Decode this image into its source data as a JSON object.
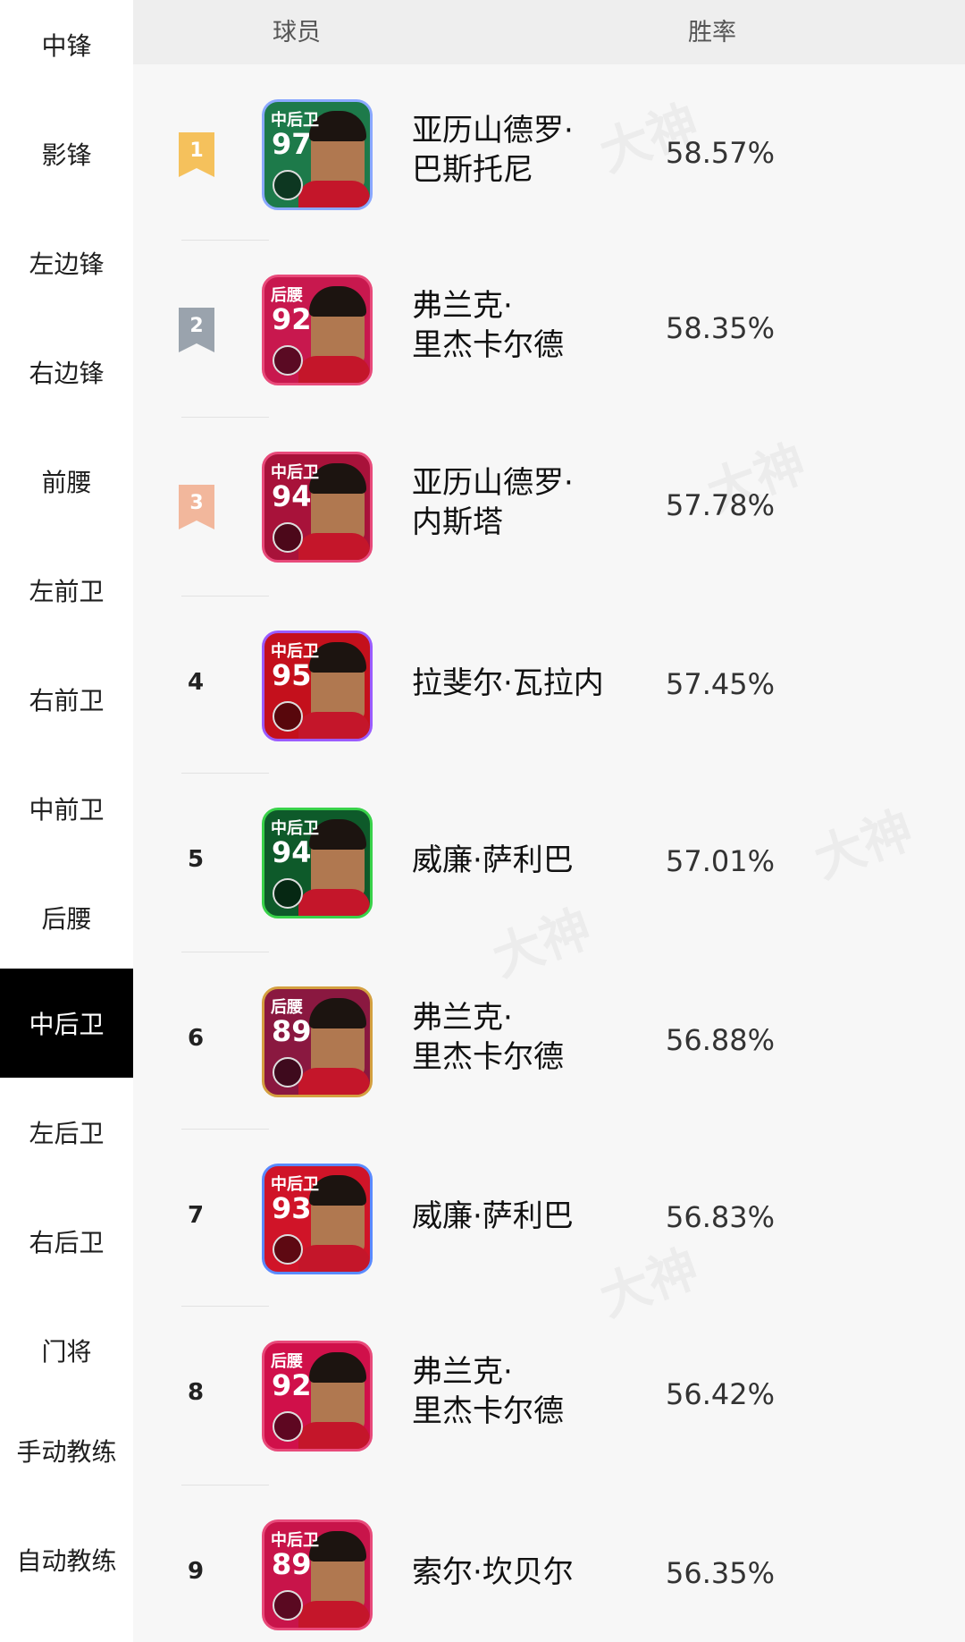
{
  "sidebar": {
    "items": [
      "中锋",
      "影锋",
      "左边锋",
      "右边锋",
      "前腰",
      "左前卫",
      "右前卫",
      "中前卫",
      "后腰",
      "中后卫",
      "左后卫",
      "右后卫",
      "门将",
      "手动教练",
      "自动教练"
    ],
    "active_index": 9
  },
  "header": {
    "player_col": "球员",
    "winrate_col": "胜率"
  },
  "watermark": "大神",
  "rows": [
    {
      "rank": "1",
      "position": "中后卫",
      "rating": "97",
      "name_line1": "亚历山德罗·",
      "name_line2": "巴斯托尼",
      "winrate": "58.57%",
      "badge_color": "#f5c15c",
      "card_bg": "#1d7a4a",
      "frame_color": "#8aa8ff"
    },
    {
      "rank": "2",
      "position": "后腰",
      "rating": "92",
      "name_line1": "弗兰克·",
      "name_line2": "里杰卡尔德",
      "winrate": "58.35%",
      "badge_color": "#9aa3ad",
      "card_bg": "#c8184e",
      "frame_color": "#e84a7a"
    },
    {
      "rank": "3",
      "position": "中后卫",
      "rating": "94",
      "name_line1": "亚历山德罗·",
      "name_line2": "内斯塔",
      "winrate": "57.78%",
      "badge_color": "#f2b79c",
      "card_bg": "#a8123a",
      "frame_color": "#e84a7a"
    },
    {
      "rank": "4",
      "position": "中后卫",
      "rating": "95",
      "name_line1": "拉斐尔·瓦拉内",
      "name_line2": "",
      "winrate": "57.45%",
      "badge_color": "",
      "card_bg": "#c4101c",
      "frame_color": "#9a5cff"
    },
    {
      "rank": "5",
      "position": "中后卫",
      "rating": "94",
      "name_line1": "威廉·萨利巴",
      "name_line2": "",
      "winrate": "57.01%",
      "badge_color": "",
      "card_bg": "#0e5a2a",
      "frame_color": "#39d24a"
    },
    {
      "rank": "6",
      "position": "后腰",
      "rating": "89",
      "name_line1": "弗兰克·",
      "name_line2": "里杰卡尔德",
      "winrate": "56.88%",
      "badge_color": "",
      "card_bg": "#8a1840",
      "frame_color": "#d4a040"
    },
    {
      "rank": "7",
      "position": "中后卫",
      "rating": "93",
      "name_line1": "威廉·萨利巴",
      "name_line2": "",
      "winrate": "56.83%",
      "badge_color": "",
      "card_bg": "#d01428",
      "frame_color": "#5a8aff"
    },
    {
      "rank": "8",
      "position": "后腰",
      "rating": "92",
      "name_line1": "弗兰克·",
      "name_line2": "里杰卡尔德",
      "winrate": "56.42%",
      "badge_color": "",
      "card_bg": "#d0104a",
      "frame_color": "#e84a7a"
    },
    {
      "rank": "9",
      "position": "中后卫",
      "rating": "89",
      "name_line1": "索尔·坎贝尔",
      "name_line2": "",
      "winrate": "56.35%",
      "badge_color": "",
      "card_bg": "#c8144a",
      "frame_color": "#e84a7a"
    }
  ]
}
